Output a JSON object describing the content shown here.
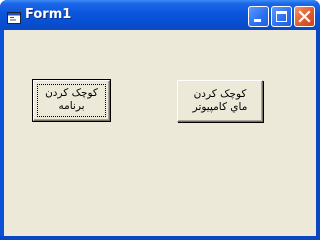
{
  "window": {
    "title": "Form1",
    "app_icon": "form-window-icon",
    "controls": {
      "minimize_icon": "minimize-icon",
      "maximize_icon": "maximize-icon",
      "close_icon": "close-icon"
    }
  },
  "buttons": [
    {
      "line1": "كوچک کردن",
      "line2": "برنامه",
      "focused": true
    },
    {
      "line1": "كوچک کردن",
      "line2": "ماي كامپيوتر",
      "focused": false
    }
  ],
  "colors": {
    "titlebar": "#0a55dc",
    "client": "#ece9d8",
    "close_button": "#e15a2d"
  }
}
